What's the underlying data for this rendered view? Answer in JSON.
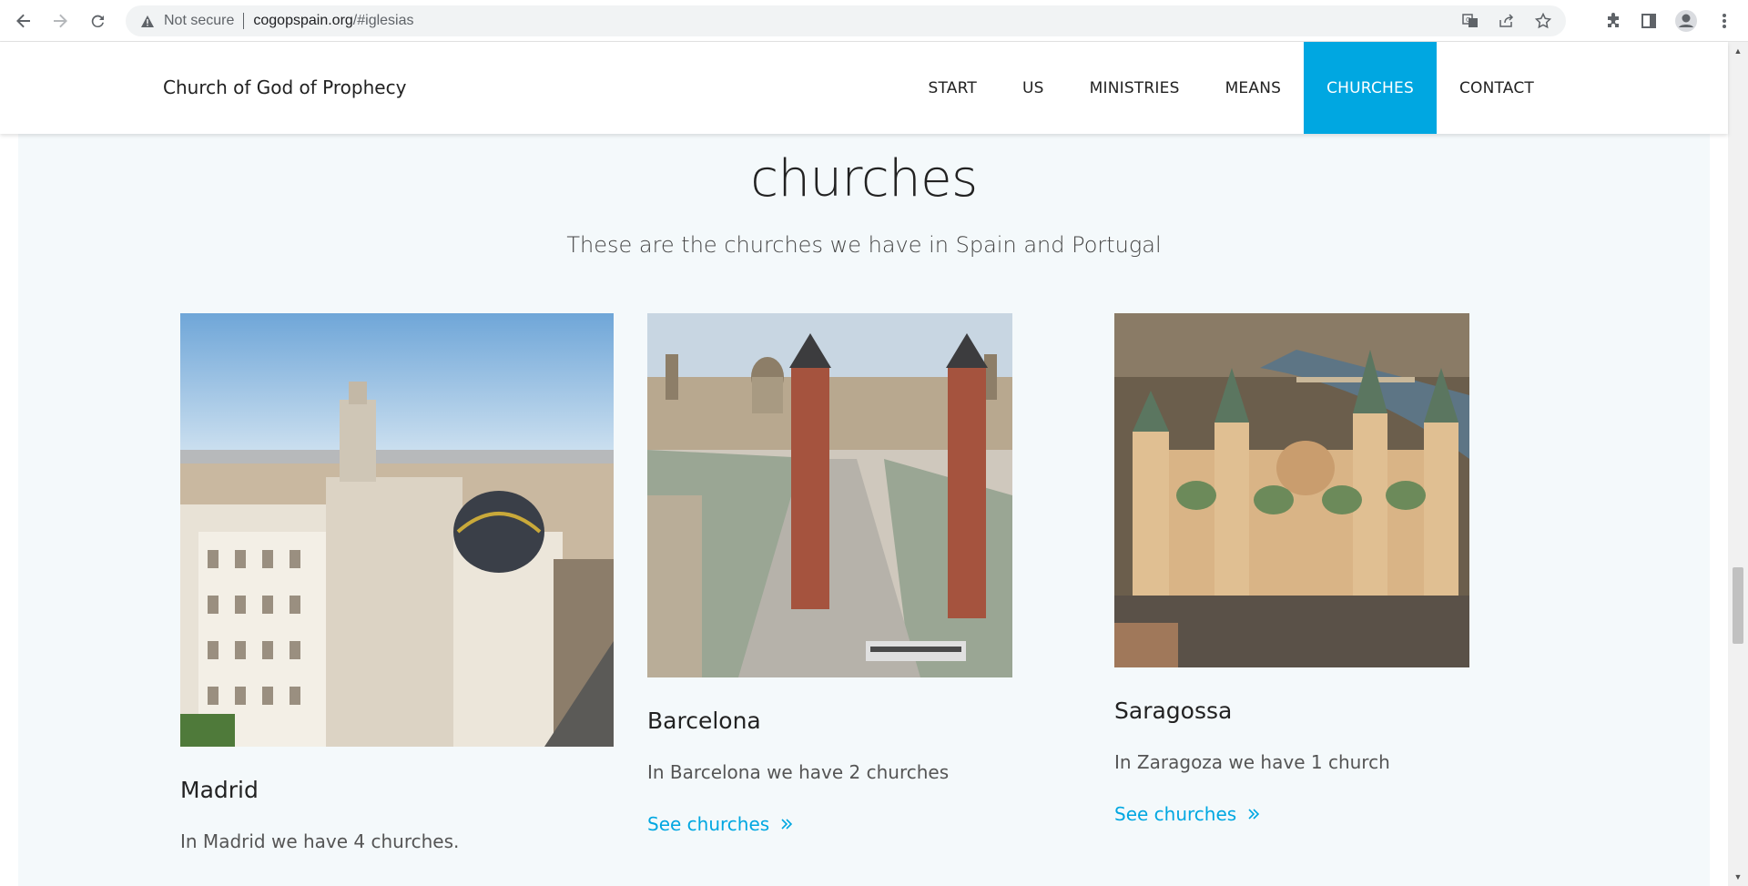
{
  "browser": {
    "security_label": "Not secure",
    "url_domain": "cogopspain.org",
    "url_path": "/#iglesias"
  },
  "header": {
    "brand": "Church of God of Prophecy",
    "menu": [
      {
        "label": "START"
      },
      {
        "label": "US"
      },
      {
        "label": "MINISTRIES"
      },
      {
        "label": "MEANS"
      },
      {
        "label": "CHURCHES",
        "active": true
      },
      {
        "label": "CONTACT"
      }
    ]
  },
  "section": {
    "title": "churches",
    "subtitle": "These are the churches we have in Spain and Portugal"
  },
  "cards": [
    {
      "title": "Madrid",
      "text": "In Madrid we have 4 churches.",
      "link": ""
    },
    {
      "title": "Barcelona",
      "text": "In Barcelona we have 2 churches",
      "link": "See churches"
    },
    {
      "title": "Saragossa",
      "text": "In Zaragoza we have 1 church",
      "link": "See churches"
    }
  ],
  "colors": {
    "accent": "#00a7e1",
    "section_bg": "#f4f9fb"
  }
}
